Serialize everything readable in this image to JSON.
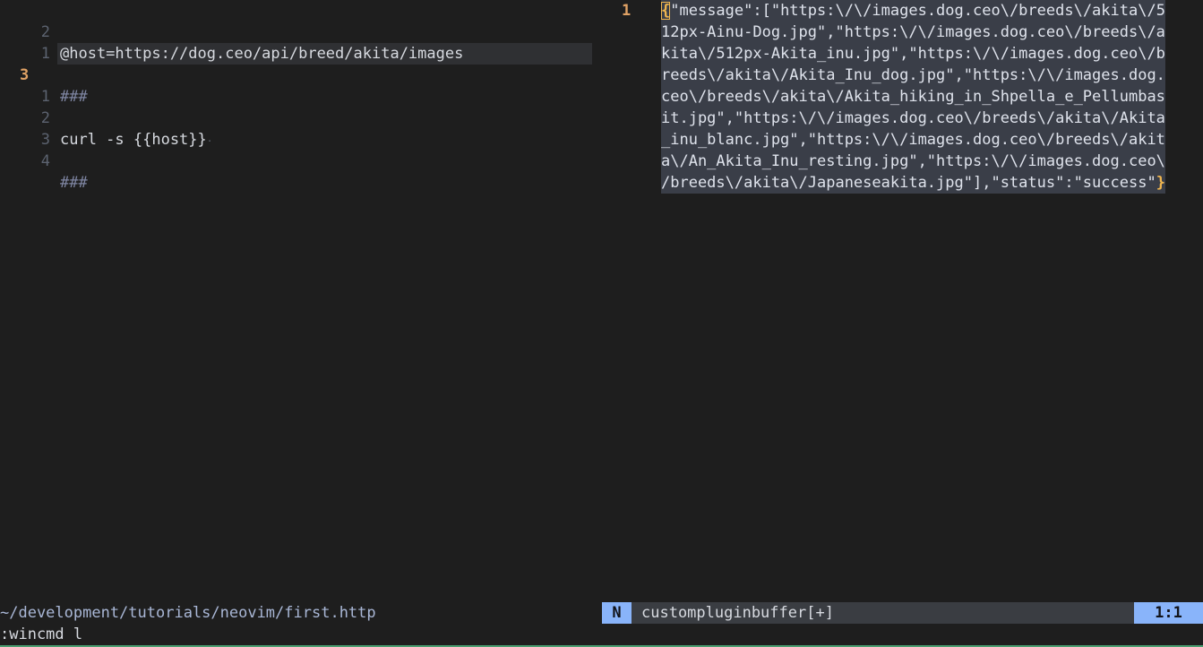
{
  "left_buffer": {
    "lines": [
      {
        "number": "2",
        "text": "@host=https://dog.ceo/api/breed/akita/images",
        "kind": "normal",
        "current": false
      },
      {
        "number": "1",
        "text": "",
        "kind": "normal",
        "current": false
      },
      {
        "number": "3",
        "text": "###",
        "kind": "comment",
        "current": true
      },
      {
        "number": "1",
        "text": "",
        "kind": "normal",
        "current": false
      },
      {
        "number": "2",
        "text": "curl -s {{host}}",
        "kind": "normal",
        "current": false
      },
      {
        "number": "3",
        "text": "",
        "kind": "normal",
        "current": false
      },
      {
        "number": "4",
        "text": "###",
        "kind": "comment",
        "current": false
      }
    ],
    "trailing_marker": "·"
  },
  "right_buffer": {
    "line_number": "1",
    "open_brace": "{",
    "close_brace": "}",
    "rows": [
      "\"message\":[\"https:\\/\\/images.dog.ceo\\/breeds\\/akita\\/5",
      "12px-Ainu-Dog.jpg\",\"https:\\/\\/images.dog.ceo\\/breeds\\/a",
      "kita\\/512px-Akita_inu.jpg\",\"https:\\/\\/images.dog.ceo\\/b",
      "reeds\\/akita\\/Akita_Inu_dog.jpg\",\"https:\\/\\/images.dog.",
      "ceo\\/breeds\\/akita\\/Akita_hiking_in_Shpella_e_Pellumbas",
      "it.jpg\",\"https:\\/\\/images.dog.ceo\\/breeds\\/akita\\/Akita",
      "_inu_blanc.jpg\",\"https:\\/\\/images.dog.ceo\\/breeds\\/akit",
      "a\\/An_Akita_Inu_resting.jpg\",\"https:\\/\\/images.dog.ceo\\",
      "/breeds\\/akita\\/Japaneseakita.jpg\"],\"status\":\"success\""
    ]
  },
  "statusline": {
    "left_path": "~/development/tutorials/neovim/first.http",
    "mode": "N",
    "buffer_name": "custompluginbuffer[+]",
    "position": "1:1"
  },
  "cmdline": {
    "text": ":wincmd l"
  },
  "colors": {
    "background": "#1e1e1e",
    "line_number": "#5c6370",
    "current_line_number": "#e0a265",
    "comment": "#7f86a3",
    "selection": "#3a3e48",
    "mode_badge": "#89b4fa",
    "bottom_border": "#4a9e70"
  }
}
